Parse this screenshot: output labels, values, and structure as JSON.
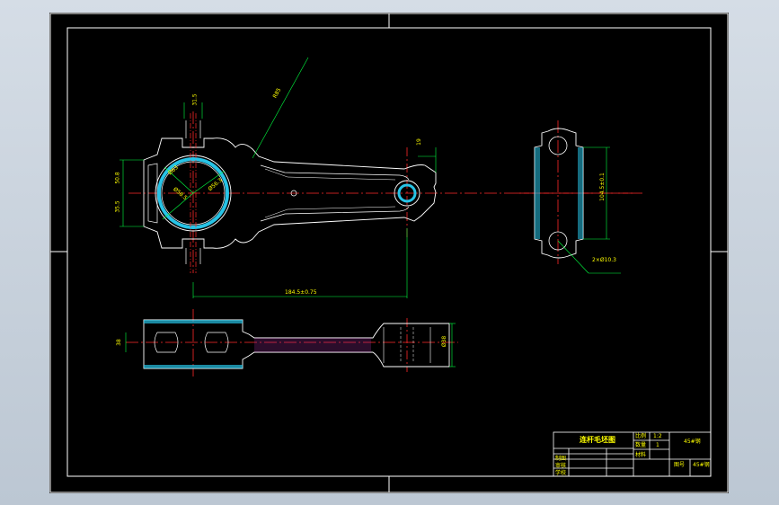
{
  "title_block": {
    "drawing_title": "连杆毛坯图",
    "scale_label": "比例",
    "scale_value": "1:2",
    "quantity_label": "数量",
    "quantity_value": "1",
    "material_value": "45#钢",
    "weight_label": "材料",
    "sheet_label": "图号",
    "drawn_label": "制图",
    "checked_label": "审核",
    "school_label": "学校"
  },
  "dimensions": {
    "crank_width": "50.8",
    "crank_height": "35.5",
    "top_small": "31.5",
    "radius_big": "R85",
    "bore_big": "Ø63",
    "bore_big2": "Ø56.3",
    "bore_inner": "Ø58.5",
    "center_distance": "184.5±0.75",
    "small_end_h": "19",
    "right_height": "104.5±0.1",
    "bolt_callout": "2×Ø10.3",
    "bottom_left": "38",
    "bottom_right": "Ø38"
  },
  "colors": {
    "outline": "#ffffff",
    "centerline": "#ff2a2a",
    "dimension": "#00ff40",
    "hatch": "#27c3e6",
    "text": "#ffff00",
    "title_border": "#ffffff"
  }
}
